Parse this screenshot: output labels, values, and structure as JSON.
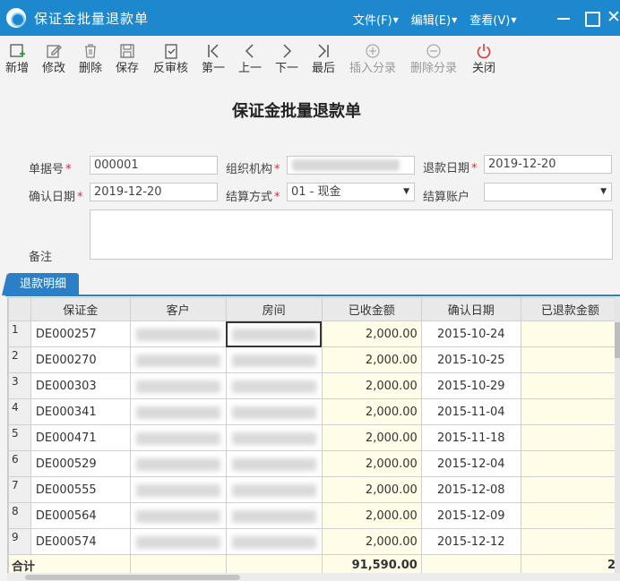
{
  "window": {
    "title": "保证金批量退款单",
    "menus": [
      {
        "label": "文件(F)"
      },
      {
        "label": "编辑(E)"
      },
      {
        "label": "查看(V)"
      }
    ],
    "close_glyph": "✕"
  },
  "toolbar": {
    "items": [
      {
        "label": "新增",
        "icon": "add-icon",
        "enabled": true
      },
      {
        "label": "修改",
        "icon": "edit-icon",
        "enabled": true
      },
      {
        "label": "删除",
        "icon": "trash-icon",
        "enabled": true
      },
      {
        "label": "保存",
        "icon": "save-icon",
        "enabled": true
      },
      {
        "label": "反审核",
        "icon": "unapprove-icon",
        "enabled": true
      },
      {
        "label": "第一",
        "icon": "first-icon",
        "enabled": true
      },
      {
        "label": "上一",
        "icon": "prev-icon",
        "enabled": true
      },
      {
        "label": "下一",
        "icon": "next-icon",
        "enabled": true
      },
      {
        "label": "最后",
        "icon": "last-icon",
        "enabled": true
      },
      {
        "label": "插入分录",
        "icon": "insert-row-icon",
        "enabled": false
      },
      {
        "label": "删除分录",
        "icon": "delete-row-icon",
        "enabled": false
      },
      {
        "label": "关闭",
        "icon": "power-icon",
        "enabled": true
      }
    ]
  },
  "form": {
    "title": "保证金批量退款单",
    "doc_no_label": "单据号",
    "doc_no_value": "000001",
    "org_label": "组织机构",
    "org_value": "",
    "refund_date_label": "退款日期",
    "refund_date_value": "2019-12-20",
    "confirm_date_label": "确认日期",
    "confirm_date_value": "2019-12-20",
    "settle_method_label": "结算方式",
    "settle_method_value": "01 - 现金",
    "settle_account_label": "结算账户",
    "settle_account_value": "",
    "remark_label": "备注",
    "remark_value": "",
    "required_mark": "*",
    "dropdown_glyph": "▼"
  },
  "detail": {
    "tab_label": "退款明细",
    "columns": [
      "保证金",
      "客户",
      "房间",
      "已收金额",
      "确认日期",
      "已退款金额"
    ],
    "rows": [
      {
        "no": "1",
        "code": "DE000257",
        "customer": "",
        "room": "",
        "received": "2,000.00",
        "confirm_date": "2015-10-24",
        "refunded": ""
      },
      {
        "no": "2",
        "code": "DE000270",
        "customer": "",
        "room": "",
        "received": "2,000.00",
        "confirm_date": "2015-10-25",
        "refunded": ""
      },
      {
        "no": "3",
        "code": "DE000303",
        "customer": "",
        "room": "",
        "received": "2,000.00",
        "confirm_date": "2015-10-29",
        "refunded": ""
      },
      {
        "no": "4",
        "code": "DE000341",
        "customer": "",
        "room": "",
        "received": "2,000.00",
        "confirm_date": "2015-11-04",
        "refunded": ""
      },
      {
        "no": "5",
        "code": "DE000471",
        "customer": "",
        "room": "",
        "received": "2,000.00",
        "confirm_date": "2015-11-18",
        "refunded": ""
      },
      {
        "no": "6",
        "code": "DE000529",
        "customer": "",
        "room": "",
        "received": "2,000.00",
        "confirm_date": "2015-12-04",
        "refunded": ""
      },
      {
        "no": "7",
        "code": "DE000555",
        "customer": "",
        "room": "",
        "received": "2,000.00",
        "confirm_date": "2015-12-08",
        "refunded": ""
      },
      {
        "no": "8",
        "code": "DE000564",
        "customer": "",
        "room": "",
        "received": "2,000.00",
        "confirm_date": "2015-12-09",
        "refunded": ""
      },
      {
        "no": "9",
        "code": "DE000574",
        "customer": "",
        "room": "",
        "received": "2,000.00",
        "confirm_date": "2015-12-12",
        "refunded": ""
      }
    ],
    "total_label": "合计",
    "total_received": "91,590.00",
    "total_refunded": "2"
  },
  "colors": {
    "titlebar": "#1e88cf",
    "tab": "#2a7fc7",
    "required": "#e23333",
    "amount_bg": "#fffde8"
  }
}
